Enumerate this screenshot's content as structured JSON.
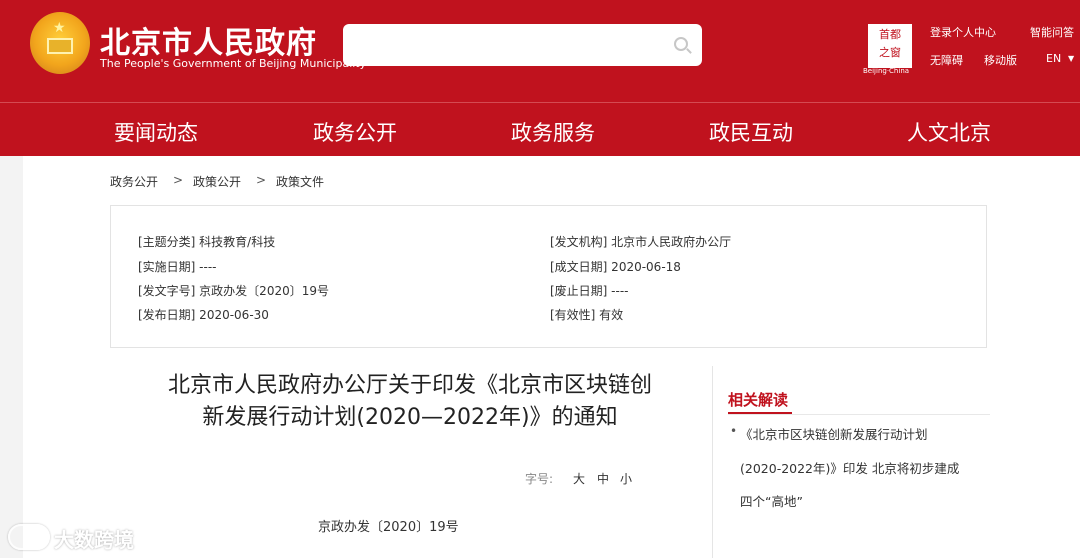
{
  "header": {
    "site_title": "北京市人民政府",
    "site_subtitle": "The People's Government of Beijing Municipality",
    "search": {
      "placeholder": ""
    },
    "portal_logo": {
      "chars_top": "首都",
      "chars_bottom": "之窗",
      "caption": "Beijing·China"
    },
    "links": {
      "login": "登录个人中心",
      "smart_qa": "智能问答",
      "accessible": "无障碍",
      "mobile": "移动版",
      "language": "EN"
    },
    "accent_color": "#c0121e"
  },
  "nav": {
    "items": [
      "要闻动态",
      "政务公开",
      "政务服务",
      "政民互动",
      "人文北京"
    ]
  },
  "breadcrumb": {
    "items": [
      "政务公开",
      "政策公开",
      "政策文件"
    ],
    "separator": ">"
  },
  "meta": {
    "topic": "[主题分类] 科技教育/科技",
    "issuer": "[发文机构] 北京市人民政府办公厅",
    "effective_date": "[实施日期] ----",
    "written_date": "[成文日期] 2020-06-18",
    "doc_no": "[发文字号] 京政办发〔2020〕19号",
    "repeal_date": "[废止日期] ----",
    "publish_date": "[发布日期] 2020-06-30",
    "validity": "[有效性] 有效"
  },
  "document": {
    "title_line1": "北京市人民政府办公厅关于印发《北京市区块链创",
    "title_line2": "新发展行动计划(2020—2022年)》的通知",
    "font_size_label": "字号:",
    "font_sizes": [
      "大",
      "中",
      "小"
    ],
    "number": "京政办发〔2020〕19号"
  },
  "related": {
    "title": "相关解读",
    "bullet": "•",
    "item_lines": [
      "《北京市区块链创新发展行动计划",
      "(2020-2022年)》印发 北京将初步建成",
      "四个“高地”"
    ]
  },
  "watermark": {
    "text": "大数跨境"
  }
}
